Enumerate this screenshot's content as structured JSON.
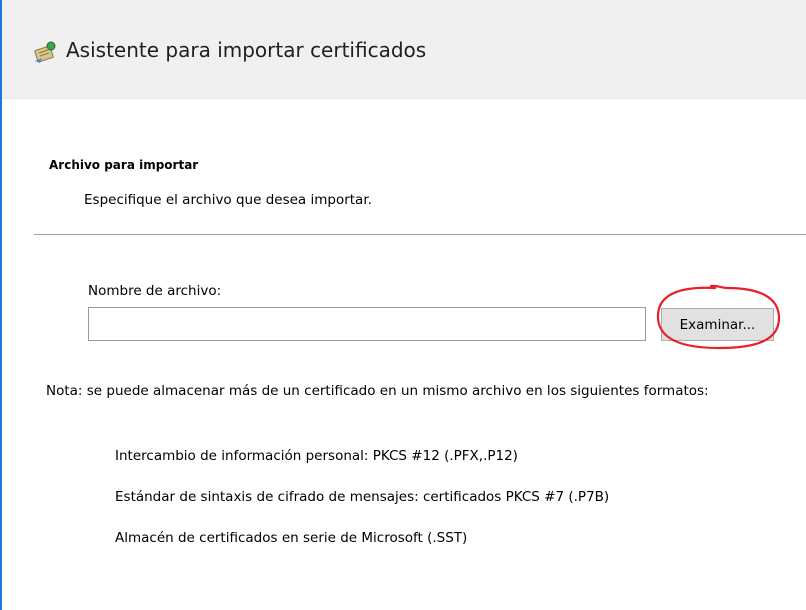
{
  "window": {
    "title": "Asistente para importar certificados",
    "icon": "certificate-wizard-icon"
  },
  "section": {
    "title": "Archivo para importar",
    "subtitle": "Especifique el archivo que desea importar."
  },
  "file_field": {
    "label": "Nombre de archivo:",
    "value": "",
    "placeholder": ""
  },
  "browse_button": {
    "label": "Examinar..."
  },
  "highlight": {
    "color": "#e8202a",
    "target": "browse_button"
  },
  "note": {
    "text": "Nota: se puede almacenar más de un certificado en un mismo archivo en los siguientes formatos:"
  },
  "formats": [
    "Intercambio de información personal: PKCS #12 (.PFX,.P12)",
    "Estándar de sintaxis de cifrado de mensajes: certificados PKCS #7 (.P7B)",
    "Almacén de certificados en serie de Microsoft (.SST)"
  ],
  "colors": {
    "accent_edge": "#1a78d6",
    "header_bg": "#f0f0f0",
    "button_bg": "#e1e1e1"
  }
}
